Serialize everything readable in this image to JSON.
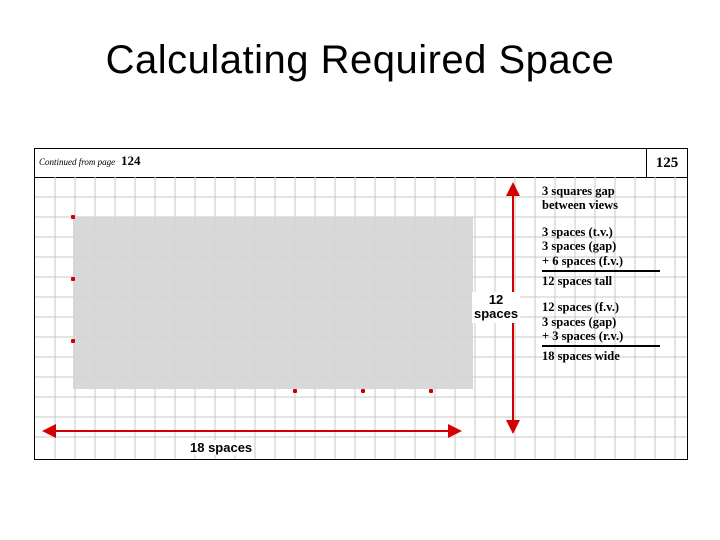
{
  "title": "Calculating Required Space",
  "notebook": {
    "continued_label": "Continued from page",
    "continued_page": "124",
    "page_number": "125"
  },
  "dims": {
    "vertical_label_value": "12",
    "vertical_label_unit": "spaces",
    "horizontal_label": "18 spaces"
  },
  "notes": {
    "gap": {
      "l1": "3 squares gap",
      "l2": "between views"
    },
    "tall": {
      "l1": "3 spaces (t.v.)",
      "l2": "3 spaces (gap)",
      "l3": "+ 6 spaces (f.v.)",
      "sum": "12 spaces tall"
    },
    "wide": {
      "l1": "12 spaces (f.v.)",
      "l2": "3 spaces (gap)",
      "l3": "+ 3 spaces (r.v.)",
      "sum": "18 spaces wide"
    }
  }
}
